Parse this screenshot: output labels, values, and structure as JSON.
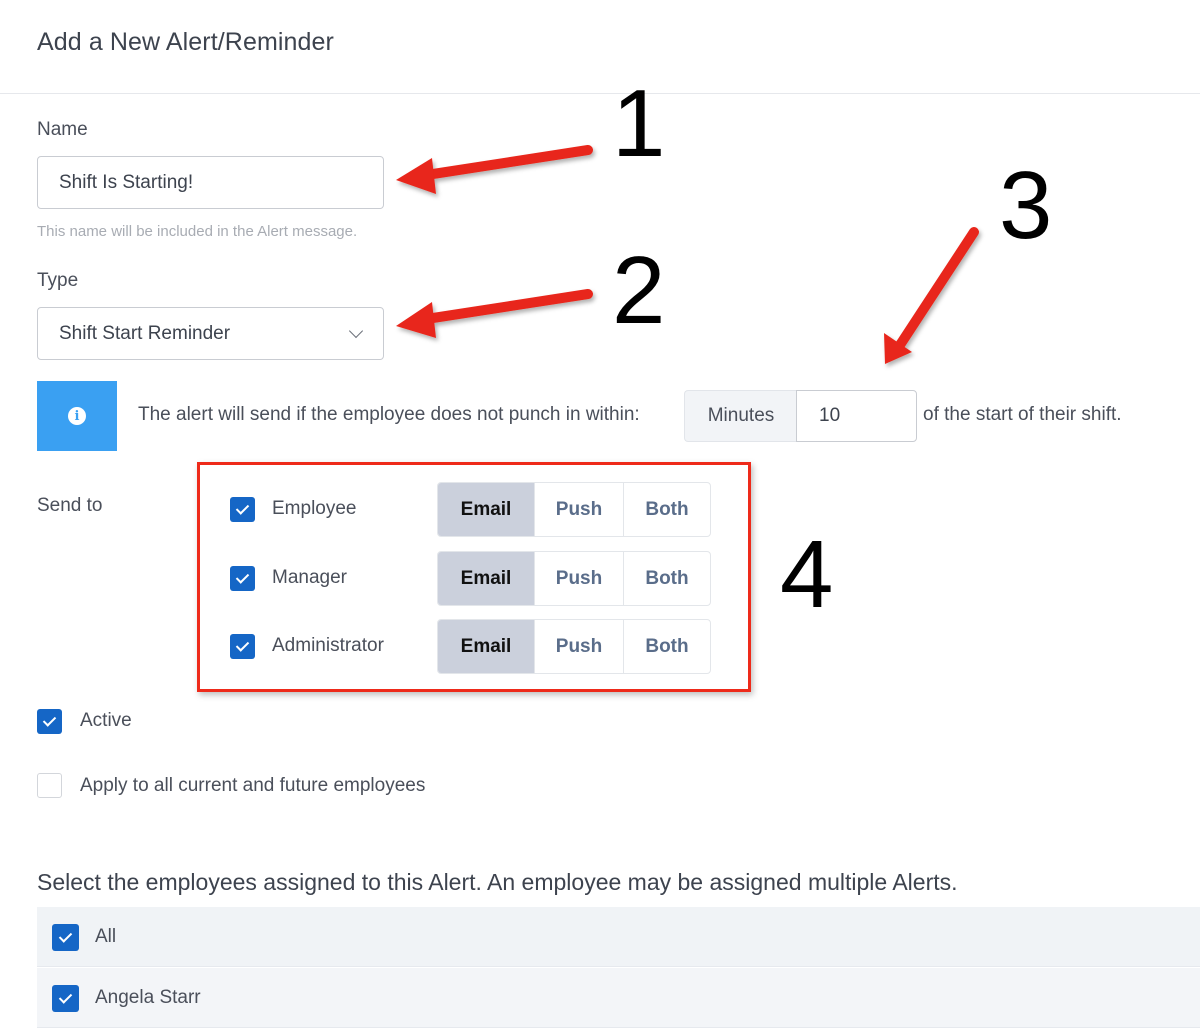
{
  "page": {
    "title": "Add a New Alert/Reminder"
  },
  "form": {
    "name": {
      "label": "Name",
      "value": "Shift Is Starting!",
      "hint": "This name will be included in the Alert message."
    },
    "type": {
      "label": "Type",
      "selected": "Shift Start Reminder",
      "icon": "chevron-down-icon"
    },
    "info": {
      "icon": "info-icon",
      "text": "The alert will send if the employee does not punch in within:",
      "unit_addon": "Minutes",
      "minutes_value": "10",
      "tail_text": "of the start of their shift.",
      "accent_color": "#3aa0f2"
    },
    "send_to": {
      "label": "Send to",
      "recipients": [
        {
          "label": "Employee",
          "checked": true,
          "options": [
            "Email",
            "Push",
            "Both"
          ],
          "selected": "Email"
        },
        {
          "label": "Manager",
          "checked": true,
          "options": [
            "Email",
            "Push",
            "Both"
          ],
          "selected": "Email"
        },
        {
          "label": "Administrator",
          "checked": true,
          "options": [
            "Email",
            "Push",
            "Both"
          ],
          "selected": "Email"
        }
      ]
    },
    "active": {
      "label": "Active",
      "checked": true
    },
    "apply_all": {
      "label": "Apply to all current and future employees",
      "checked": false
    }
  },
  "employees": {
    "heading": "Select the employees assigned to this Alert. An employee may be assigned multiple Alerts.",
    "rows": [
      {
        "name": "All",
        "checked": true
      },
      {
        "name": "Angela Starr",
        "checked": true
      }
    ]
  },
  "annotations": {
    "numbers": [
      "1",
      "2",
      "3",
      "4"
    ],
    "arrow_color": "#e8281a",
    "box_color": "#ee2a1a"
  },
  "colors": {
    "checkbox": "#1566c6",
    "segment_active_bg": "#cbd0dc",
    "segment_text": "#5a6d8a"
  }
}
